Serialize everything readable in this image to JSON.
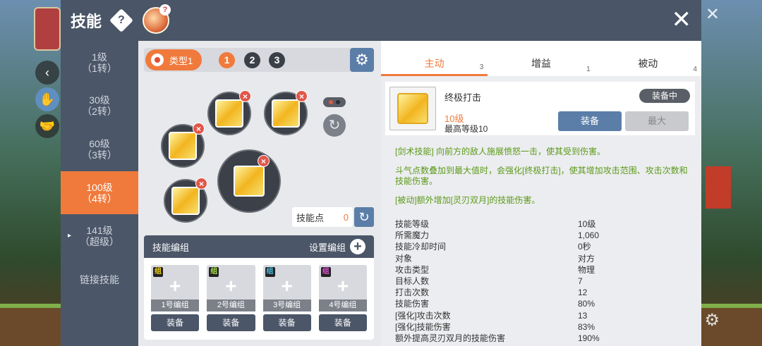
{
  "window": {
    "title": "技能"
  },
  "nav": [
    {
      "line1": "1级",
      "line2": "（1转）",
      "active": false,
      "arrow": ""
    },
    {
      "line1": "30级",
      "line2": "（2转）",
      "active": false,
      "arrow": ""
    },
    {
      "line1": "60级",
      "line2": "（3转）",
      "active": false,
      "arrow": ""
    },
    {
      "line1": "100级",
      "line2": "（4转）",
      "active": true,
      "arrow": ""
    },
    {
      "line1": "141级",
      "line2": "（超级）",
      "active": false,
      "arrow": "▸"
    },
    {
      "line1": "链接技能",
      "line2": "",
      "active": false,
      "arrow": ""
    }
  ],
  "typebar": {
    "type_label": "类型1",
    "pages": [
      "1",
      "2",
      "3"
    ]
  },
  "skill_points": {
    "label": "技能点",
    "value": "0"
  },
  "edit_group": {
    "title": "技能编组",
    "setup_label": "设置编组",
    "groups": [
      {
        "tag": "组",
        "tag_color": "#f2d21a",
        "label": "1号编组",
        "button": "装备"
      },
      {
        "tag": "组",
        "tag_color": "#a6e04a",
        "label": "2号编组",
        "button": "装备"
      },
      {
        "tag": "组",
        "tag_color": "#4ac0e8",
        "label": "3号编组",
        "button": "装备"
      },
      {
        "tag": "组",
        "tag_color": "#e050d8",
        "label": "4号编组",
        "button": "装备"
      }
    ]
  },
  "tabs": [
    {
      "label": "主动",
      "count": "3",
      "active": true
    },
    {
      "label": "增益",
      "count": "1",
      "active": false
    },
    {
      "label": "被动",
      "count": "4",
      "active": false
    }
  ],
  "skill": {
    "name": "终极打击",
    "level": "10级",
    "max_level": "最高等级10",
    "equipped_badge": "装备中",
    "equip_button": "装备",
    "max_button": "最大"
  },
  "description": [
    "[剑术技能] 向前方的敌人施展愤怒一击，使其受到伤害。",
    "斗气点数叠加到最大值时，会强化[终极打击]，使其增加攻击范围、攻击次数和技能伤害。",
    "[被动]额外增加[灵刃双月]的技能伤害。"
  ],
  "stats": [
    {
      "k": "技能等级",
      "v": "10级"
    },
    {
      "k": "所需魔力",
      "v": "1,060"
    },
    {
      "k": "技能冷却时间",
      "v": "0秒"
    },
    {
      "k": "对象",
      "v": "对方"
    },
    {
      "k": "攻击类型",
      "v": "物理"
    },
    {
      "k": "目标人数",
      "v": "7"
    },
    {
      "k": "打击次数",
      "v": "12"
    },
    {
      "k": "技能伤害",
      "v": "80%"
    },
    {
      "k": "[强化]攻击次数",
      "v": "13"
    },
    {
      "k": "[强化]技能伤害",
      "v": "83%"
    },
    {
      "k": "额外提高灵刃双月的技能伤害",
      "v": "190%"
    }
  ],
  "colors": {
    "accent": "#f07a3c",
    "nav_bg": "#4b5668",
    "button_blue": "#5b7ea8",
    "desc_green": "#5a9a18"
  }
}
